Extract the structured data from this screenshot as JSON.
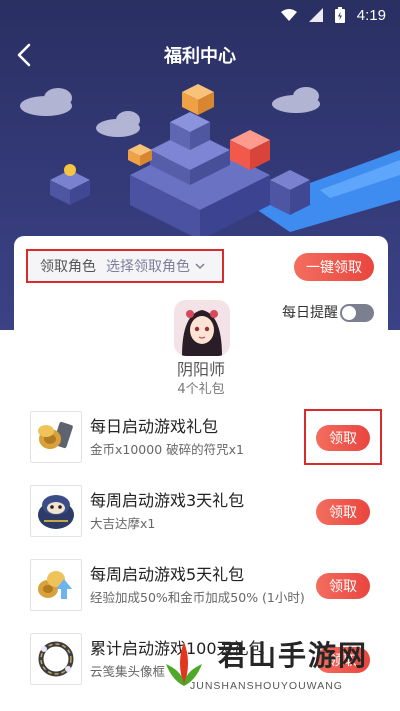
{
  "status_bar": {
    "time": "4:19"
  },
  "header": {
    "title": "福利中心"
  },
  "role": {
    "label": "领取角色",
    "value": "选择领取角色"
  },
  "one_key_label": "一键领取",
  "daily_reminder": {
    "label": "每日提醒",
    "enabled": false
  },
  "game": {
    "name": "阴阳师",
    "gift_count": "4个礼包"
  },
  "gifts": [
    {
      "title": "每日启动游戏礼包",
      "desc": "金币x10000 破碎的符咒x1",
      "button": "领取",
      "icon": "coins-and-talisman-icon"
    },
    {
      "title": "每周启动游戏3天礼包",
      "desc": "大吉达摩x1",
      "button": "领取",
      "icon": "daruma-icon"
    },
    {
      "title": "每周启动游戏5天礼包",
      "desc": "经验加成50%和金币加成50% (1小时)",
      "button": "领取",
      "icon": "bonus-buff-icon"
    },
    {
      "title": "累计启动游戏100天礼包",
      "desc": "云笺集头像框",
      "button": "领取",
      "icon": "avatar-frame-icon"
    }
  ],
  "watermark": {
    "text": "君山手游网",
    "sub": "JUNSHANSHOUYOUWANG"
  },
  "colors": {
    "accent": "#e9453e",
    "header_bg": "#2f3570",
    "highlight": "#d92b2b"
  }
}
